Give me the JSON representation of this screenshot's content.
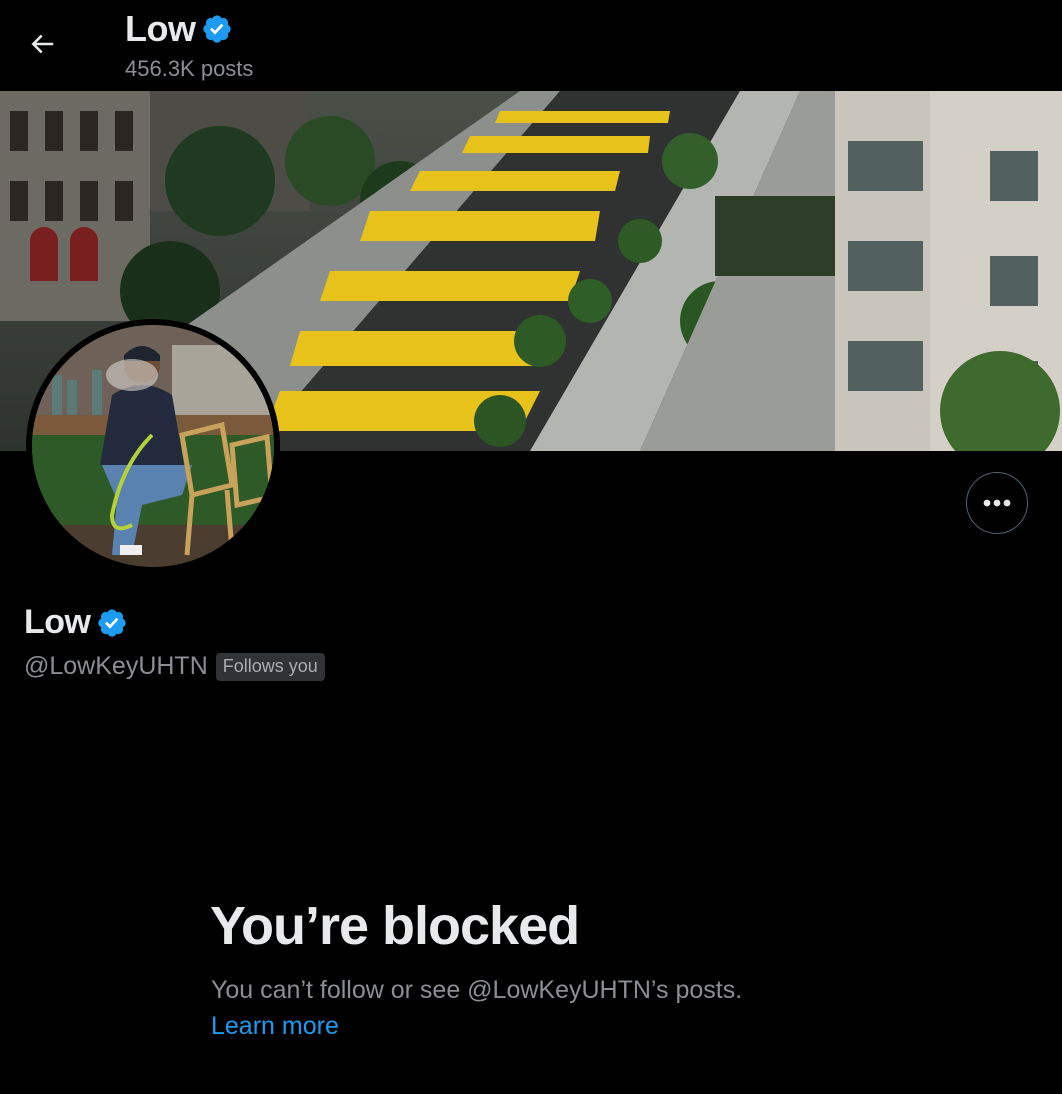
{
  "header": {
    "display_name": "Low",
    "posts_count": "456.3K posts"
  },
  "profile": {
    "display_name": "Low",
    "handle": "@LowKeyUHTN",
    "follows_you_badge": "Follows you"
  },
  "blocked": {
    "title": "You’re blocked",
    "description": "You can’t follow or see @LowKeyUHTN’s posts.",
    "learn_more": "Learn more"
  },
  "icons": {
    "back": "arrow-left-icon",
    "verified": "verified-badge-icon",
    "more": "more-horizontal-icon"
  },
  "colors": {
    "background": "#000000",
    "primary_text": "#e7e9ea",
    "secondary_text": "#8b8f94",
    "verified_blue": "#1d9bf0",
    "link_blue": "#1d9bf0",
    "badge_bg": "#2f3336",
    "border": "#536471"
  }
}
